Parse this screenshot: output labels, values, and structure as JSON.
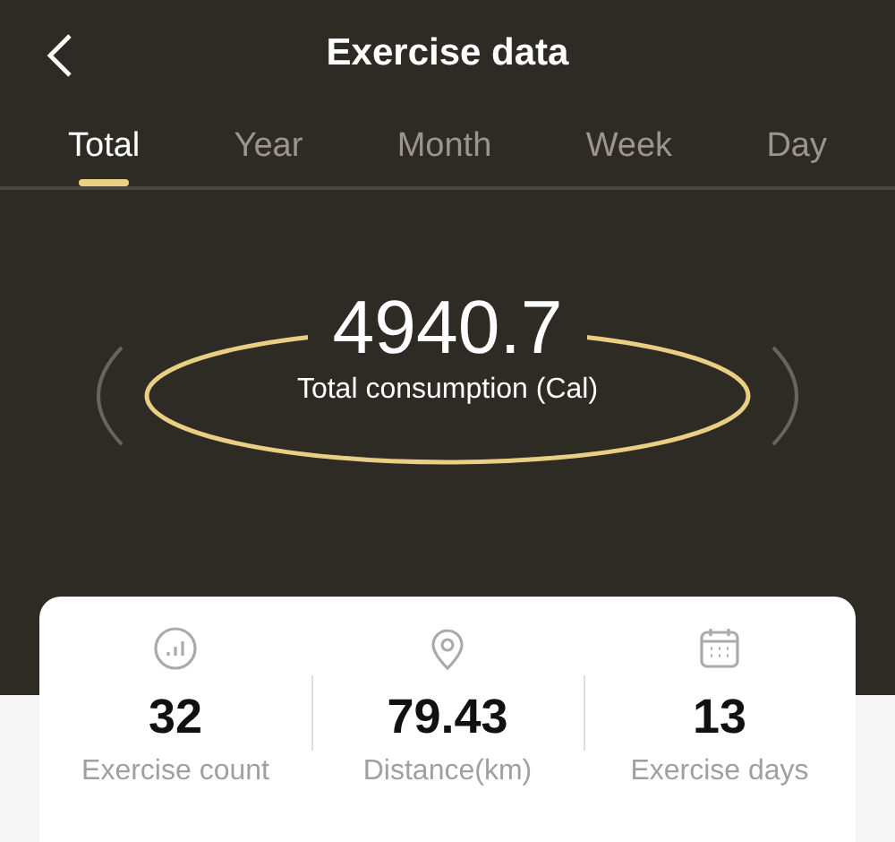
{
  "header": {
    "title": "Exercise data"
  },
  "tabs": [
    {
      "label": "Total",
      "selected": true
    },
    {
      "label": "Year",
      "selected": false
    },
    {
      "label": "Month",
      "selected": false
    },
    {
      "label": "Week",
      "selected": false
    },
    {
      "label": "Day",
      "selected": false
    }
  ],
  "summary": {
    "value": "4940.7",
    "label": "Total consumption (Cal)"
  },
  "stats": [
    {
      "value": "32",
      "label": "Exercise count"
    },
    {
      "value": "79.43",
      "label": "Distance(km)"
    },
    {
      "value": "13",
      "label": "Exercise days"
    }
  ]
}
